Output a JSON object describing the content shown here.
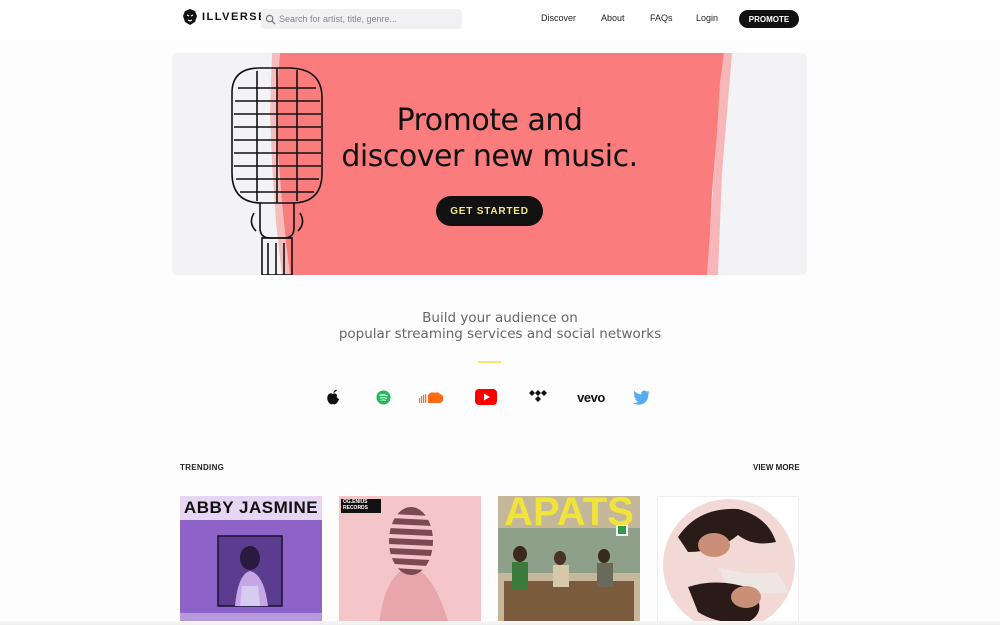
{
  "header": {
    "logo_text": "ILLVERSE",
    "search_placeholder": "Search for artist, title, genre...",
    "nav": [
      "Discover",
      "About",
      "FAQs",
      "Login"
    ],
    "promote_label": "PROMOTE"
  },
  "hero": {
    "title_line1": "Promote and",
    "title_line2": "discover new music.",
    "cta_label": "GET STARTED"
  },
  "audience": {
    "line1": "Build your audience on",
    "line2": "popular streaming services and social networks",
    "services": [
      "apple-icon",
      "spotify-icon",
      "soundcloud-icon",
      "youtube-icon",
      "tidal-icon",
      "vevo-logo",
      "twitter-icon"
    ],
    "vevo_text": "vevo"
  },
  "trending": {
    "label": "TRENDING",
    "view_more": "VIEW MORE",
    "cards": [
      {
        "title": "ABBY JASMINE"
      },
      {
        "title": "OG.ENIUS RECORDS"
      },
      {
        "title": "APATS"
      },
      {
        "title": ""
      }
    ]
  },
  "colors": {
    "accent_pink": "#fb7c7c",
    "accent_yellow": "#f1ea6a",
    "button_dark": "#111111"
  }
}
